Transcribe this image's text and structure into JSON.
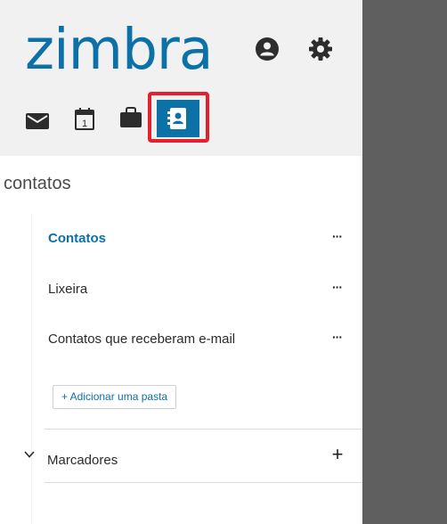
{
  "header": {
    "logo_text": "zimbra",
    "icons": {
      "user": "user-circle-icon",
      "settings": "gear-icon"
    },
    "app_tabs": [
      {
        "name": "mail",
        "icon": "envelope-icon"
      },
      {
        "name": "calendar",
        "icon": "calendar-icon",
        "day": "1"
      },
      {
        "name": "briefcase",
        "icon": "briefcase-icon"
      },
      {
        "name": "contacts",
        "icon": "address-book-icon",
        "active": true
      }
    ],
    "colors": {
      "brand": "#0b71a7",
      "highlight": "#e5202d"
    }
  },
  "sidebar": {
    "title": "contatos",
    "folders": [
      {
        "label": "Contatos",
        "active": true,
        "menu": "···"
      },
      {
        "label": "Lixeira",
        "menu": "···"
      },
      {
        "label": "Contatos que receberam e-mail",
        "menu": "···"
      }
    ],
    "add_folder_label": "+ Adicionar uma pasta",
    "tags": {
      "label": "Marcadores",
      "add": "+"
    }
  }
}
